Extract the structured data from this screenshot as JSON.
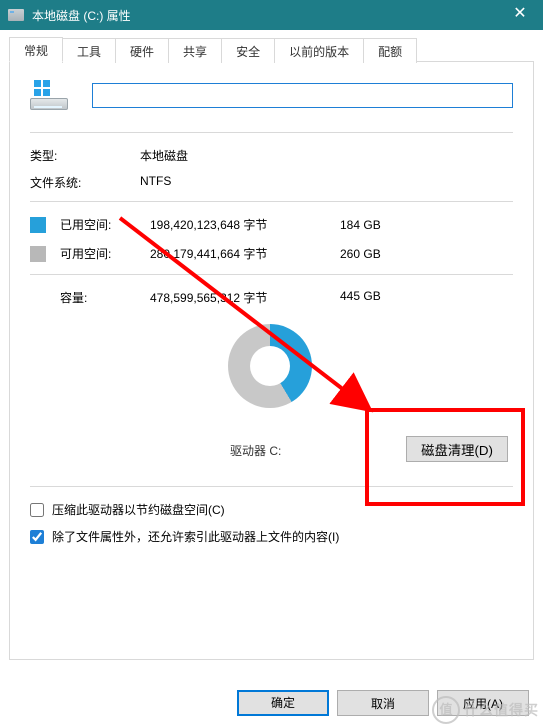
{
  "window": {
    "title": "本地磁盘 (C:) 属性",
    "close_glyph": "✕"
  },
  "tabs": [
    "常规",
    "工具",
    "硬件",
    "共享",
    "安全",
    "以前的版本",
    "配额"
  ],
  "active_tab": 0,
  "general": {
    "volume_name": "",
    "type_label": "类型:",
    "type_value": "本地磁盘",
    "fs_label": "文件系统:",
    "fs_value": "NTFS",
    "used_label": "已用空间:",
    "used_bytes": "198,420,123,648 字节",
    "used_gb": "184 GB",
    "free_label": "可用空间:",
    "free_bytes": "280,179,441,664 字节",
    "free_gb": "260 GB",
    "capacity_label": "容量:",
    "capacity_bytes": "478,599,565,312 字节",
    "capacity_gb": "445 GB",
    "drive_label": "驱动器 C:",
    "cleanup_button": "磁盘清理(D)",
    "compress_label": "压缩此驱动器以节约磁盘空间(C)",
    "compress_checked": false,
    "index_label": "除了文件属性外，还允许索引此驱动器上文件的内容(I)",
    "index_checked": true
  },
  "footer": {
    "ok": "确定",
    "cancel": "取消",
    "apply": "应用(A)"
  },
  "watermark": {
    "circle": "值",
    "text": "什么值得买"
  },
  "chart_data": {
    "type": "pie",
    "title": "驱动器 C:",
    "series": [
      {
        "name": "已用空间",
        "value": 184,
        "unit": "GB",
        "bytes": 198420123648,
        "color": "#26a0da"
      },
      {
        "name": "可用空间",
        "value": 260,
        "unit": "GB",
        "bytes": 280179441664,
        "color": "#c8c8c8"
      }
    ],
    "total": {
      "name": "容量",
      "value": 445,
      "unit": "GB",
      "bytes": 478599565312
    }
  }
}
